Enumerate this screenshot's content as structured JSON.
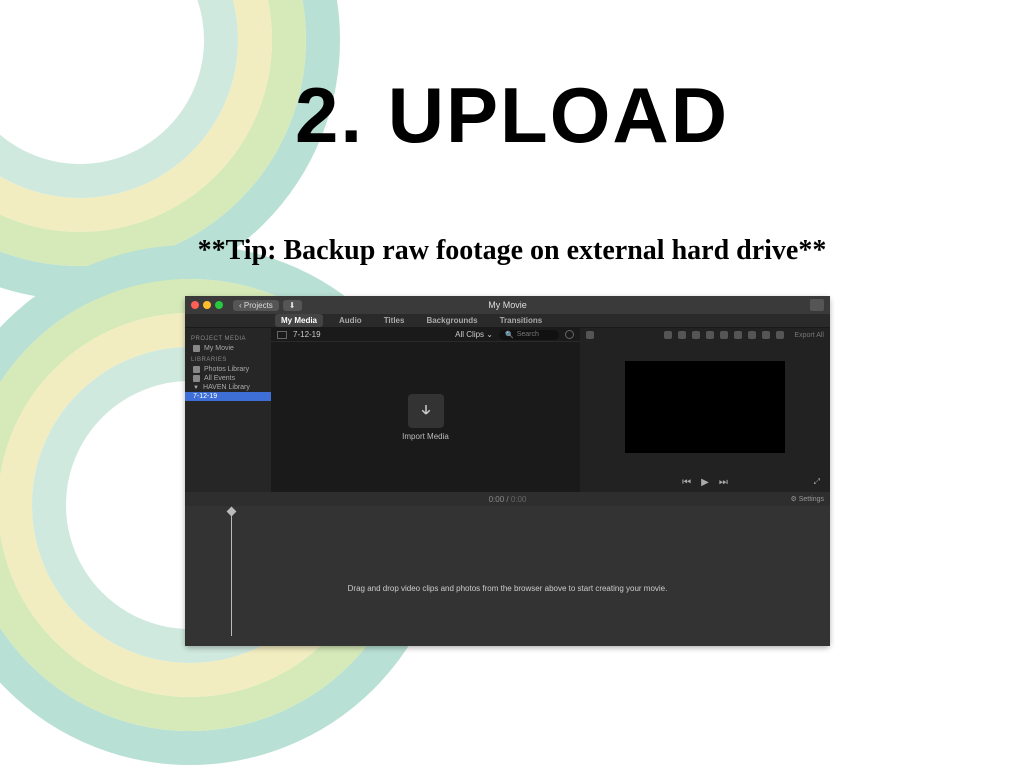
{
  "slide": {
    "title": "2. UPLOAD",
    "tip": "**Tip: Backup raw footage on external hard drive**"
  },
  "imovie": {
    "window_title": "My Movie",
    "back_button": "Projects",
    "tabs": [
      "My Media",
      "Audio",
      "Titles",
      "Backgrounds",
      "Transitions"
    ],
    "sidebar": {
      "section1": "PROJECT MEDIA",
      "item1": "My Movie",
      "section2": "LIBRARIES",
      "item2": "Photos Library",
      "item3": "All Events",
      "item4": "HAVEN Library",
      "item5": "7-12-19"
    },
    "browser": {
      "date": "7-12-19",
      "filter": "All Clips",
      "search_placeholder": "Search",
      "import_label": "Import Media"
    },
    "viewer": {
      "export_label": "Export All"
    },
    "timeline": {
      "time": "0:00",
      "time_total": "0:00",
      "settings": "Settings",
      "dropzone": "Drag and drop video clips and photos from the browser above to start creating your movie."
    }
  }
}
